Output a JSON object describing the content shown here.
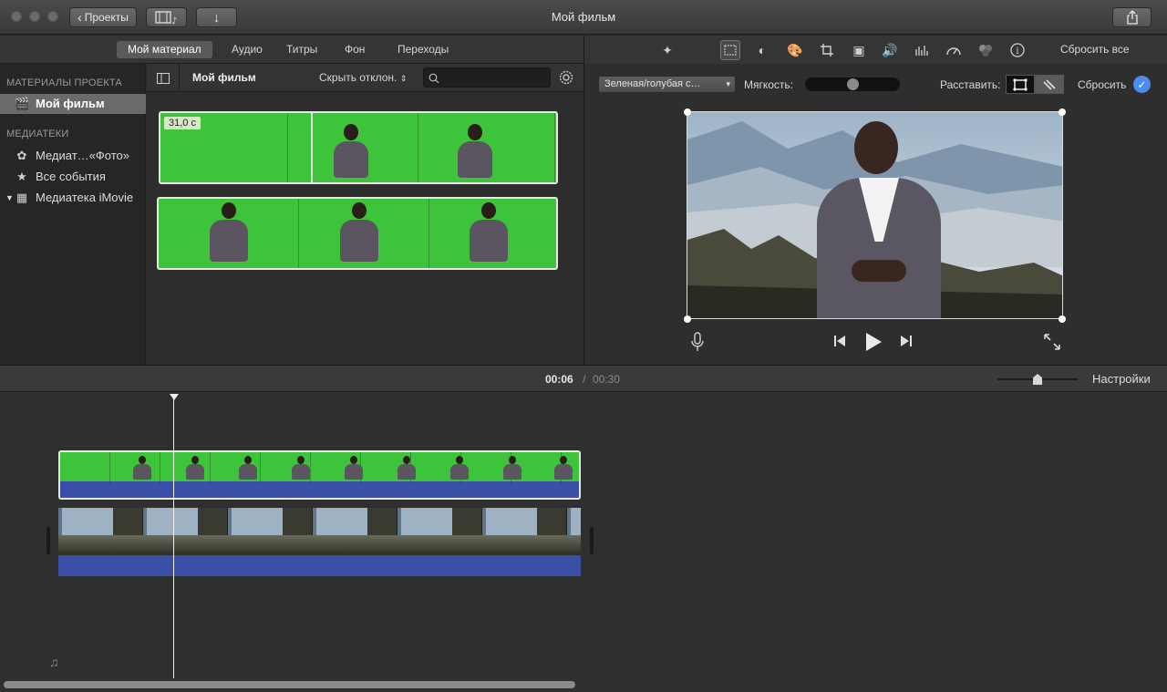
{
  "window": {
    "title": "Мой фильм",
    "back_button": "Проекты"
  },
  "top_tabs": [
    {
      "label": "Мой материал",
      "active": true
    },
    {
      "label": "Аудио",
      "active": false
    },
    {
      "label": "Титры",
      "active": false
    },
    {
      "label": "Фон",
      "active": false
    },
    {
      "label": "Переходы",
      "active": false
    }
  ],
  "sidebar": {
    "project_section": "МАТЕРИАЛЫ ПРОЕКТА",
    "project_item": "Мой фильм",
    "libraries_section": "МЕДИАТЕКИ",
    "libraries": [
      {
        "label": "Медиат…«Фото»",
        "icon": "photos-flower-icon"
      },
      {
        "label": "Все события",
        "icon": "star-icon"
      },
      {
        "label": "Медиатека iMovie",
        "icon": "grid-icon"
      }
    ]
  },
  "browser": {
    "title": "Мой фильм",
    "filter_label": "Скрыть отклон.",
    "search_placeholder": "",
    "clip_duration": "31,0 с"
  },
  "viewer_tools": {
    "reset_all": "Сбросить все"
  },
  "adjust": {
    "keyer_select": "Зеленая/голубая с…",
    "softness_label": "Мягкость:",
    "softness_value": 0.5,
    "arrange_label": "Расставить:",
    "reset_label": "Сбросить"
  },
  "timeline": {
    "current_time": "00:06",
    "separator": "/",
    "total_time": "00:30",
    "settings_label": "Настройки",
    "zoom_value": 0.5
  },
  "colors": {
    "green_screen": "#3ec43a",
    "audio_blue": "#3a4fa8",
    "accent_blue": "#4a8cf0"
  }
}
